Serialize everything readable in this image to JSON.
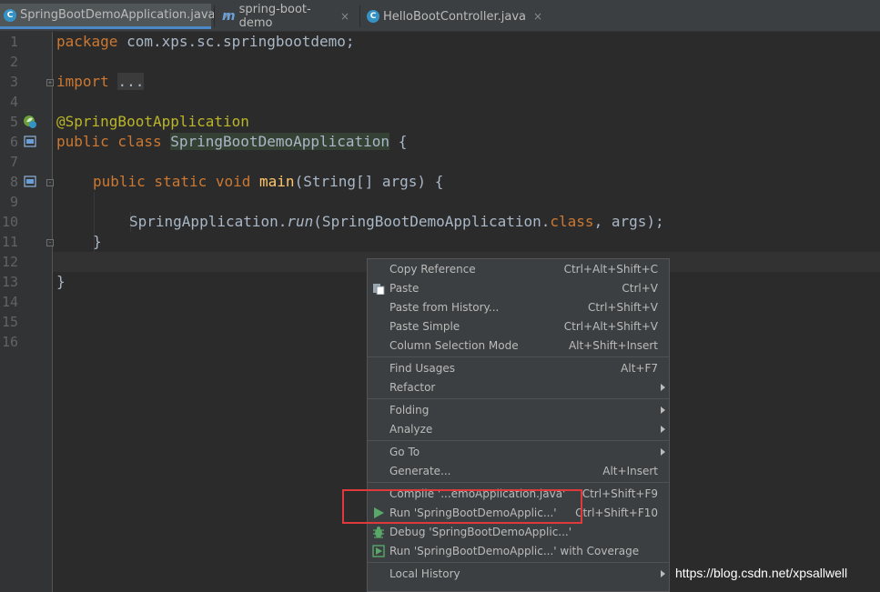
{
  "tabs": [
    {
      "label": "SpringBootDemoApplication.java",
      "icon": "spring-class-icon",
      "close": "×"
    },
    {
      "label": "spring-boot-demo",
      "icon": "maven-m-icon",
      "close": "×"
    },
    {
      "label": "HelloBootController.java",
      "icon": "class-c-icon",
      "close": "×"
    }
  ],
  "gutter": {
    "line_numbers": [
      "1",
      "2",
      "3",
      "4",
      "5",
      "6",
      "7",
      "8",
      "9",
      "10",
      "11",
      "12",
      "13",
      "14",
      "15",
      "16"
    ]
  },
  "code": {
    "l1_kw": "package",
    "l1_rest": " com.xps.sc.springbootdemo;",
    "l3_kw": "import",
    "l3_folded": "...",
    "l6_ann": "@SpringBootApplication",
    "l7_kw": "public class",
    "l7_name": "SpringBootDemoApplication",
    "l7_rest": " {",
    "l9_kw": "public static void",
    "l9_fn": "main",
    "l9_rest": "(String[] args) {",
    "l11_pre": "SpringApplication.",
    "l11_it": "run",
    "l11_mid": "(SpringBootDemoApplication.",
    "l11_kw": "class",
    "l11_end": ", args);",
    "l12": "}",
    "l14": "}"
  },
  "context_menu": {
    "items": [
      {
        "label": "Copy Reference",
        "shortcut": "Ctrl+Alt+Shift+C"
      },
      {
        "label": "Paste",
        "shortcut": "Ctrl+V",
        "icon": "paste-icon"
      },
      {
        "label": "Paste from History...",
        "shortcut": "Ctrl+Shift+V"
      },
      {
        "label": "Paste Simple",
        "shortcut": "Ctrl+Alt+Shift+V"
      },
      {
        "label": "Column Selection Mode",
        "shortcut": "Alt+Shift+Insert"
      },
      {
        "label": "Find Usages",
        "shortcut": "Alt+F7"
      },
      {
        "label": "Refactor",
        "submenu": true
      },
      {
        "label": "Folding",
        "submenu": true
      },
      {
        "label": "Analyze",
        "submenu": true
      },
      {
        "label": "Go To",
        "submenu": true
      },
      {
        "label": "Generate...",
        "shortcut": "Alt+Insert"
      },
      {
        "label": "Compile '...emoApplication.java'",
        "shortcut": "Ctrl+Shift+F9"
      },
      {
        "label": "Run 'SpringBootDemoApplic...'",
        "shortcut": "Ctrl+Shift+F10",
        "icon": "run-icon"
      },
      {
        "label": "Debug 'SpringBootDemoApplic...'",
        "icon": "debug-icon"
      },
      {
        "label": "Run 'SpringBootDemoApplic...' with Coverage",
        "icon": "coverage-icon"
      },
      {
        "label": "Local History",
        "submenu": true
      }
    ]
  },
  "watermark": "https://blog.csdn.net/xpsallwell",
  "colors": {
    "background": "#2b2b2b",
    "keyword": "#cc7832",
    "annotation": "#bbb529",
    "method": "#ffc66d",
    "highlight_box": "#e0393b"
  }
}
